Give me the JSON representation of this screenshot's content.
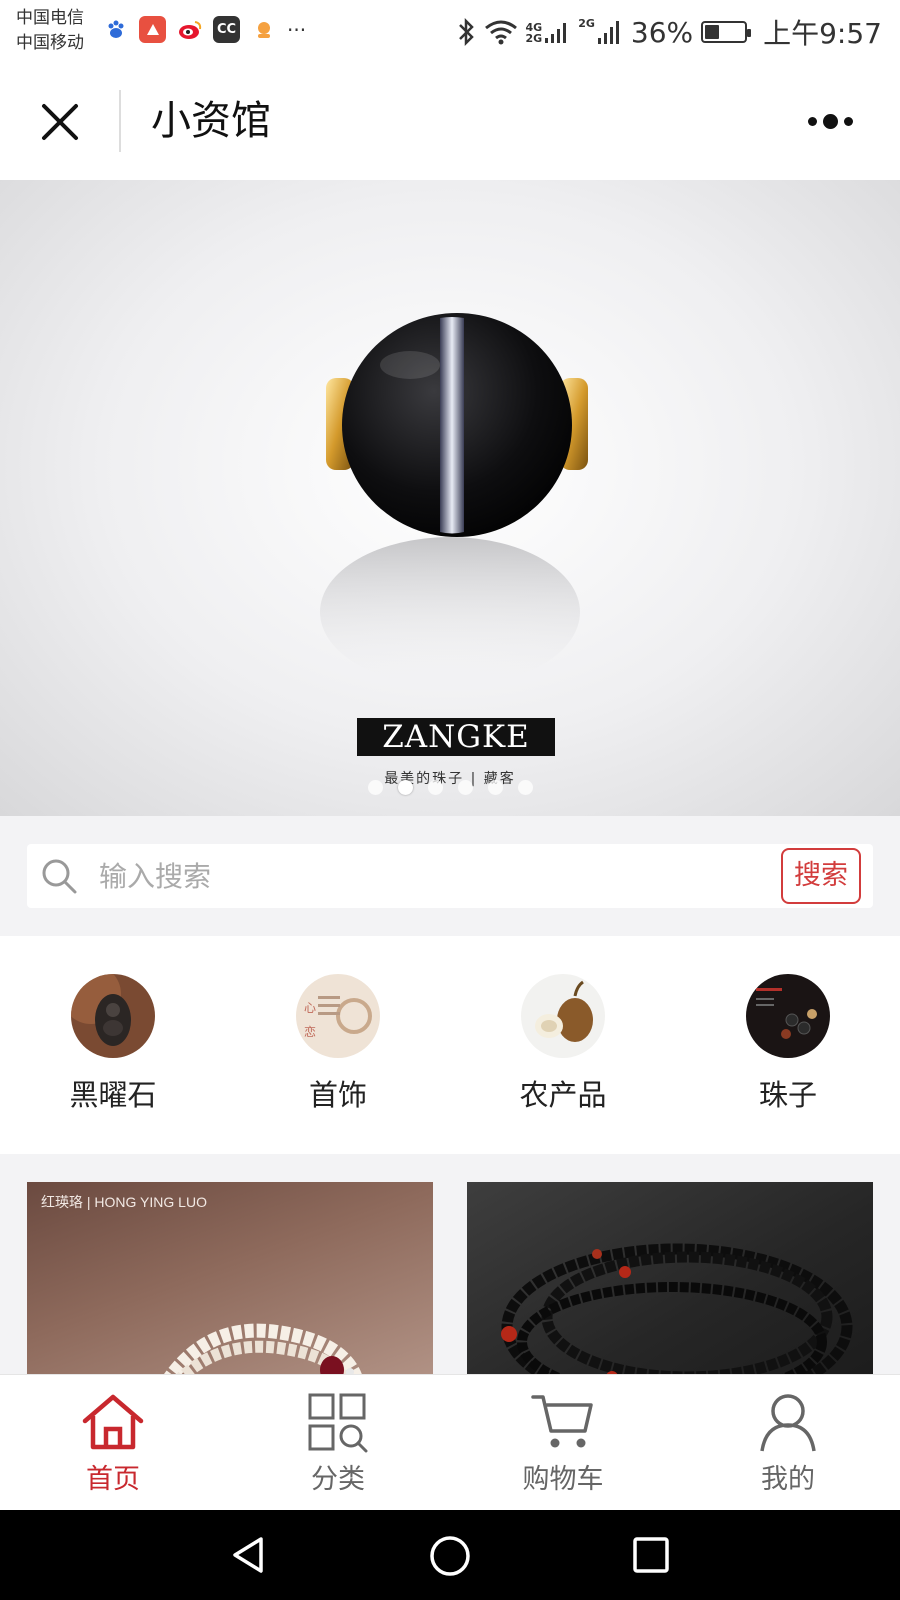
{
  "status_bar": {
    "carrier_1": "中国电信",
    "carrier_2": "中国移动",
    "network_a": "4G",
    "network_b": "2G",
    "network_c": "2G",
    "battery_percent": "36%",
    "battery_level": 0.36,
    "time": "上午9:57",
    "more": "···"
  },
  "nav": {
    "title": "小资馆"
  },
  "banner": {
    "brand": "ZANGKE",
    "slogan": "最美的珠子 | 藏客",
    "slide_count": 6,
    "active_slide": 1
  },
  "search": {
    "placeholder": "输入搜索",
    "button_label": "搜索"
  },
  "categories": [
    {
      "label": "黑曜石"
    },
    {
      "label": "首饰"
    },
    {
      "label": "农产品"
    },
    {
      "label": "珠子"
    }
  ],
  "products": [
    {
      "brand": "红瑛珞 | HONG YING LUO"
    },
    {
      "brand": ""
    }
  ],
  "tabs": [
    {
      "label": "首页",
      "icon": "home-icon",
      "active": true
    },
    {
      "label": "分类",
      "icon": "category-icon",
      "active": false
    },
    {
      "label": "购物车",
      "icon": "cart-icon",
      "active": false
    },
    {
      "label": "我的",
      "icon": "user-icon",
      "active": false
    }
  ],
  "colors": {
    "accent": "#c8282e",
    "search_button": "#d23c3c",
    "background": "#f3f3f5"
  }
}
